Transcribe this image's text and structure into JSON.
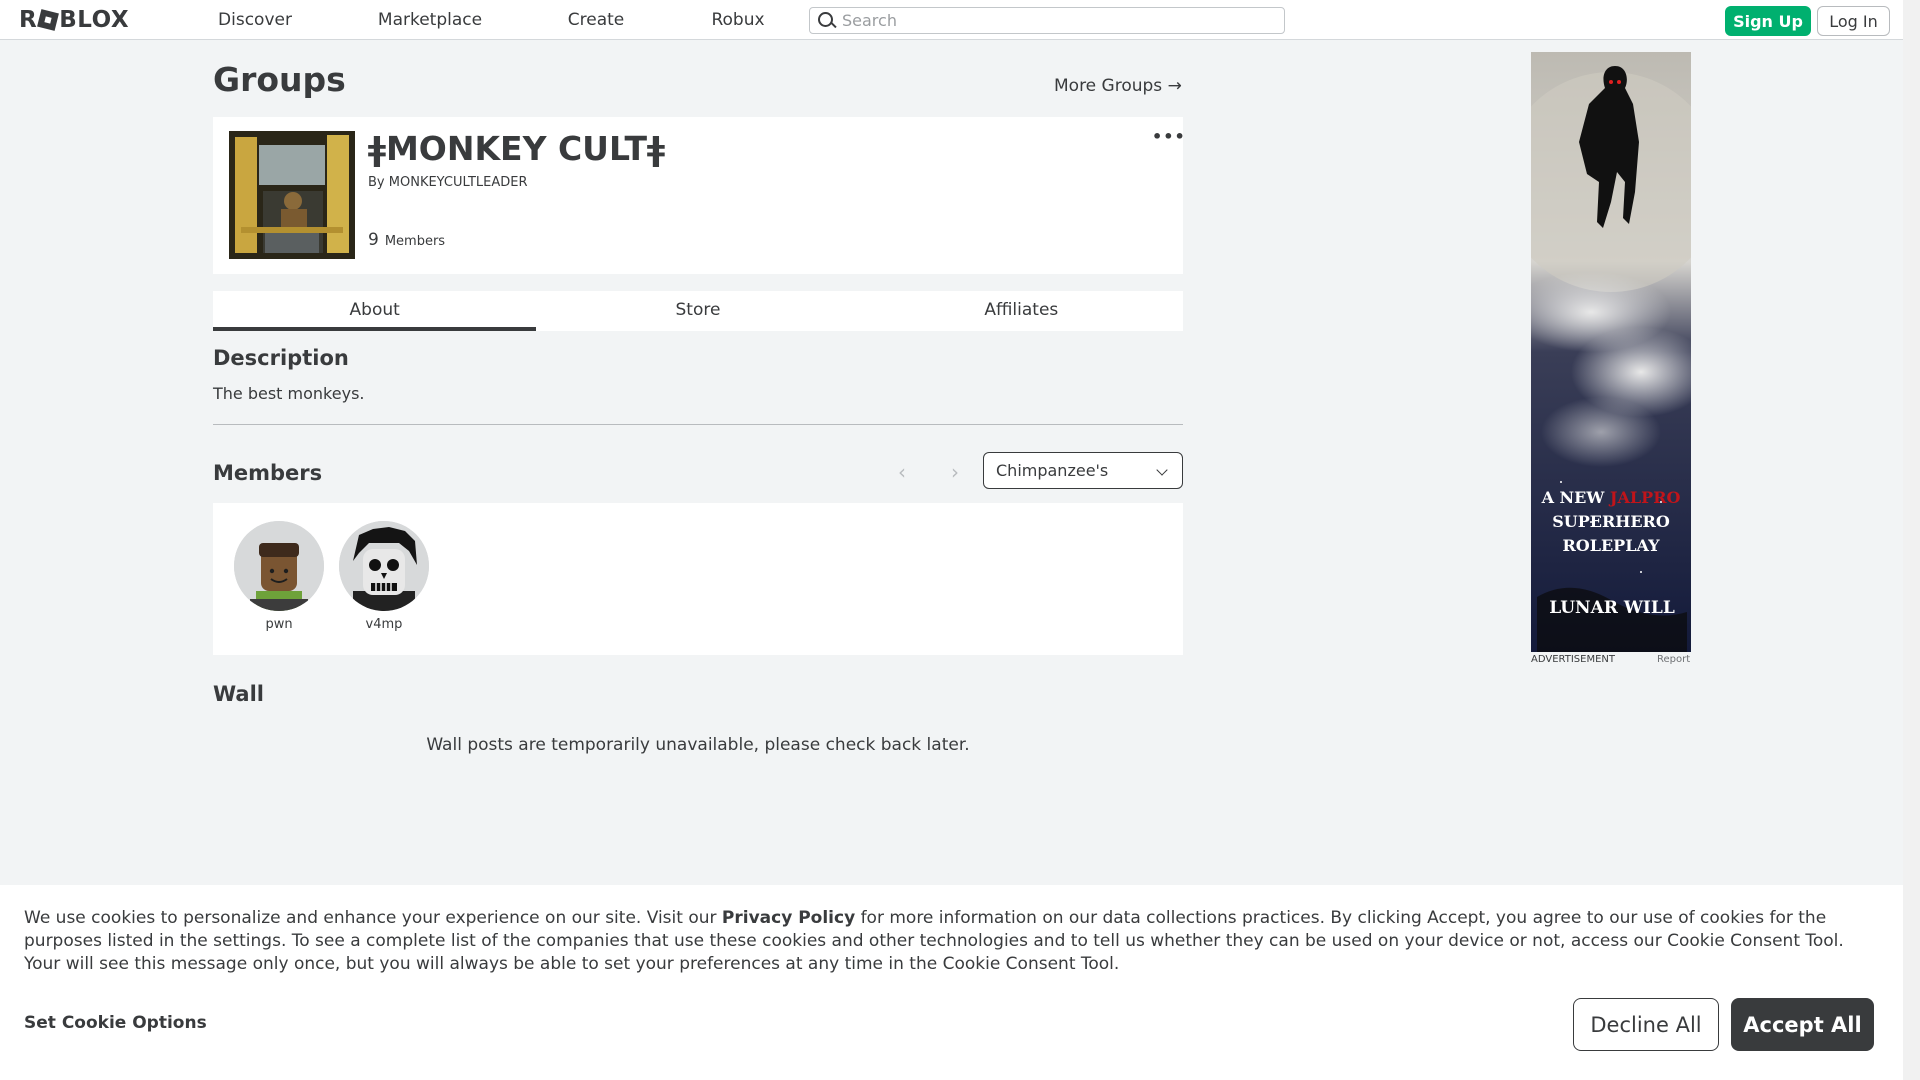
{
  "nav": {
    "logo": "ROBLOX",
    "links": [
      "Discover",
      "Marketplace",
      "Create",
      "Robux"
    ],
    "search_placeholder": "Search",
    "signup": "Sign Up",
    "login": "Log In"
  },
  "page": {
    "title": "Groups",
    "more_groups": "More Groups →"
  },
  "group": {
    "name": "ǂMONKEY CULTǂ",
    "by_prefix": "By",
    "owner": "MONKEYCULTLEADER",
    "member_count": "9",
    "members_label": "Members",
    "more_icon": "•••"
  },
  "tabs": [
    {
      "label": "About",
      "active": true
    },
    {
      "label": "Store",
      "active": false
    },
    {
      "label": "Affiliates",
      "active": false
    }
  ],
  "about": {
    "description_heading": "Description",
    "description": "The best monkeys.",
    "members_heading": "Members",
    "role_selected": "Chimpanzee's",
    "prev_icon": "‹",
    "next_icon": "›",
    "members": [
      {
        "name": "pwn"
      },
      {
        "name": "v4mp"
      }
    ],
    "wall_heading": "Wall",
    "wall_message": "Wall posts are temporarily unavailable, please check back later."
  },
  "ad": {
    "line1_a": "A NEW",
    "line1_b": "JALPRO",
    "line2": "SUPERHERO",
    "line3": "ROLEPLAY",
    "brand": "LUNAR WILL",
    "label": "ADVERTISEMENT",
    "report": "Report"
  },
  "cookie": {
    "text_a": "We use cookies to personalize and enhance your experience on our site. Visit our ",
    "link": "Privacy Policy",
    "text_b": " for more information on our data collections practices. By clicking Accept, you agree to our use of cookies for the purposes listed in the settings. To see a complete list of the companies that use these cookies and other technologies and to tell us whether they can be used on your device or not, access our Cookie Consent Tool. Your will see this message only once, but you will always be able to set your preferences at any time in the Cookie Consent Tool.",
    "set_options": "Set Cookie Options",
    "decline": "Decline All",
    "accept": "Accept All"
  },
  "colors": {
    "accent_green": "#00b06f",
    "dark": "#393b3d",
    "background": "#f2f4f5"
  }
}
